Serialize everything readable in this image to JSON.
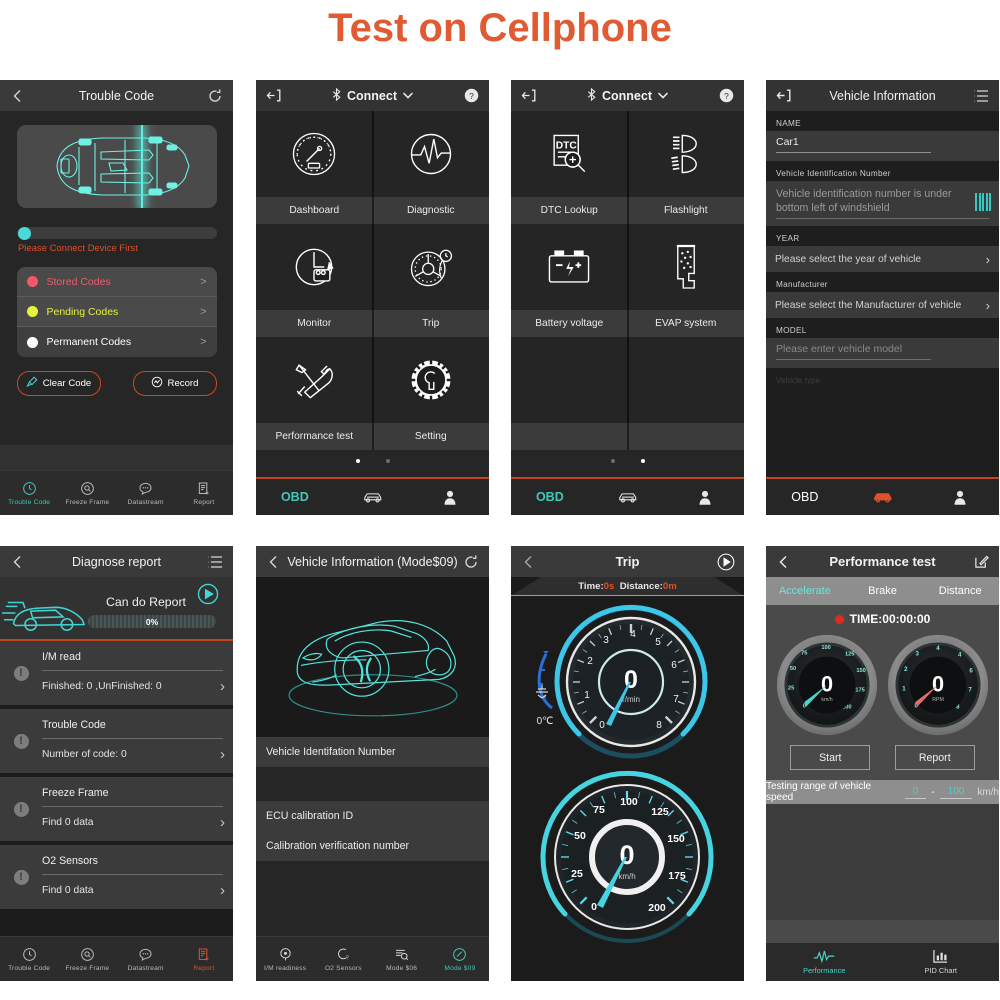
{
  "page": {
    "title": "Test on Cellphone",
    "title_color": "#e05a33"
  },
  "panels": {
    "trouble_code": {
      "header": {
        "back": "back-arrow",
        "title": "Trouble Code",
        "refresh": "refresh"
      },
      "progress_message": "Please Connect Device First",
      "codes": [
        {
          "label": "Stored Codes",
          "dot_color": "#f2596b",
          "text_color": "#f2596b",
          "chevron": ">"
        },
        {
          "label": "Pending Codes",
          "dot_color": "#e2f23d",
          "text_color": "#e2f23d",
          "chevron": ">"
        },
        {
          "label": "Permanent Codes",
          "dot_color": "#ffffff",
          "text_color": "#ffffff",
          "chevron": ">"
        }
      ],
      "buttons": {
        "clear": "Clear Code",
        "record": "Record"
      },
      "bottom_nav": [
        {
          "label": "Trouble Code",
          "icon": "clock-icon",
          "active": true
        },
        {
          "label": "Freeze Frame",
          "icon": "freeze-icon",
          "active": false
        },
        {
          "label": "Datastream",
          "icon": "chat-icon",
          "active": false
        },
        {
          "label": "Report",
          "icon": "report-icon",
          "active": false
        }
      ]
    },
    "connect_page1": {
      "header": {
        "title": "Connect",
        "bluetooth": "bluetooth-icon",
        "help": "help-icon",
        "chevron": "chevron-down-icon"
      },
      "tiles": [
        {
          "label": "Dashboard",
          "icon": "gauge-icon"
        },
        {
          "label": "Diagnostic",
          "icon": "pulse-icon"
        },
        {
          "label": "Monitor",
          "icon": "clock-camera-icon"
        },
        {
          "label": "Trip",
          "icon": "wheel-icon"
        },
        {
          "label": "Performance test",
          "icon": "tools-icon"
        },
        {
          "label": "Setting",
          "icon": "gear-wrench-icon"
        }
      ],
      "page_dots": {
        "count": 2,
        "active": 0
      },
      "tabbar": [
        {
          "label": "OBD",
          "active": true
        },
        {
          "label": "",
          "icon": "car-icon",
          "active": false
        },
        {
          "label": "",
          "icon": "person-icon",
          "active": false
        }
      ]
    },
    "connect_page2": {
      "header": {
        "title": "Connect",
        "bluetooth": "bluetooth-icon",
        "help": "help-icon",
        "chevron": "chevron-down-icon"
      },
      "tiles": [
        {
          "label": "DTC Lookup",
          "icon": "dtc-search-icon"
        },
        {
          "label": "Flashlight",
          "icon": "headlight-icon"
        },
        {
          "label": "Battery voltage",
          "icon": "battery-icon"
        },
        {
          "label": "EVAP system",
          "icon": "evap-icon"
        },
        {
          "label": "",
          "icon": ""
        },
        {
          "label": "",
          "icon": ""
        }
      ],
      "page_dots": {
        "count": 2,
        "active": 1
      },
      "tabbar": [
        {
          "label": "OBD",
          "active": true
        },
        {
          "label": "",
          "icon": "car-icon",
          "active": false
        },
        {
          "label": "",
          "icon": "person-icon",
          "active": false
        }
      ]
    },
    "vehicle_information": {
      "header": {
        "title": "Vehicle Information",
        "back": "back-arrow",
        "menu": "list-menu-icon"
      },
      "fields": [
        {
          "label": "NAME",
          "value": "Car1",
          "type": "text"
        },
        {
          "label": "Vehicle Identification Number",
          "placeholder": "Vehicle identification number is under bottom left of windshield",
          "type": "vin"
        },
        {
          "label": "YEAR",
          "placeholder": "Please select the year of vehicle",
          "type": "select"
        },
        {
          "label": "Manufacturer",
          "placeholder": "Please select the Manufacturer of vehicle",
          "type": "select"
        },
        {
          "label": "MODEL",
          "placeholder": "Please enter vehicle model",
          "type": "text"
        },
        {
          "label": "Vehicle type",
          "type": "cut"
        }
      ],
      "tabbar": [
        {
          "label": "OBD",
          "active": false
        },
        {
          "label": "",
          "icon": "car-icon",
          "active": true
        },
        {
          "label": "",
          "icon": "person-icon",
          "active": false
        }
      ]
    },
    "diagnose_report": {
      "header": {
        "title": "Diagnose report",
        "back": "back-arrow",
        "menu": "list-menu-icon"
      },
      "caption": "Can do Report",
      "progress": "0%",
      "play": "play-icon",
      "items": [
        {
          "title": "I/M read",
          "value": "Finished: 0 ,UnFinished: 0",
          "chevron": ">"
        },
        {
          "title": "Trouble Code",
          "value": "Number of code: 0",
          "chevron": ">"
        },
        {
          "title": "Freeze Frame",
          "value": "Find 0 data",
          "chevron": ">"
        },
        {
          "title": "O2 Sensors",
          "value": "Find 0 data",
          "chevron": ">"
        }
      ],
      "bottom_nav": [
        {
          "label": "Trouble Code",
          "icon": "clock-icon",
          "active": false
        },
        {
          "label": "Freeze Frame",
          "icon": "freeze-icon",
          "active": false
        },
        {
          "label": "Datastream",
          "icon": "chat-icon",
          "active": false
        },
        {
          "label": "Report",
          "icon": "report-icon",
          "active": true
        }
      ]
    },
    "mode09": {
      "header": {
        "title": "Vehicle Information (Mode$09)",
        "back": "back-arrow",
        "refresh": "refresh"
      },
      "rows": [
        "Vehicle Identifation Number",
        "ECU calibration ID",
        "Calibration verification number"
      ],
      "bottom_nav": [
        {
          "label": "I/M readiness",
          "icon": "readiness-icon",
          "active": false
        },
        {
          "label": "O2 Sensors",
          "icon": "o2-icon",
          "active": false
        },
        {
          "label": "Mode $06",
          "icon": "mode06-icon",
          "active": false
        },
        {
          "label": "Mode $09",
          "icon": "mode09-icon",
          "active": true
        }
      ]
    },
    "trip": {
      "header": {
        "title": "Trip",
        "back": "back-arrow",
        "play": "play-icon"
      },
      "status": {
        "time_label": "Time:",
        "time_value": "0s",
        "distance_label": "Distance:",
        "distance_value": "0m"
      },
      "tach": {
        "value": "0",
        "unit": "r/min",
        "ticks": [
          "0",
          "1",
          "2",
          "3",
          "4",
          "5",
          "6",
          "7",
          "8"
        ]
      },
      "speedo": {
        "value": "0",
        "unit": "km/h",
        "ticks": [
          "0",
          "25",
          "50",
          "75",
          "100",
          "125",
          "150",
          "175",
          "200"
        ]
      },
      "temperature": "0℃"
    },
    "performance_test": {
      "header": {
        "title": "Performance test",
        "back": "back-arrow",
        "edit": "edit-icon"
      },
      "tabs": [
        {
          "label": "Accelerate",
          "active": true
        },
        {
          "label": "Brake",
          "active": false
        },
        {
          "label": "Distance",
          "active": false
        }
      ],
      "timer": "TIME:00:00:00",
      "gauges": [
        {
          "value": "0",
          "unit": "km/h",
          "ticks": [
            "0",
            "25",
            "50",
            "75",
            "100",
            "125",
            "150",
            "175",
            "200"
          ],
          "needle_color": "#4ad3c8"
        },
        {
          "value": "0",
          "unit": "RPM",
          "ticks": [
            "0",
            "1",
            "2",
            "3",
            "4",
            "5",
            "6",
            "7",
            "8"
          ],
          "needle_color": "#e07070"
        }
      ],
      "buttons": {
        "start": "Start",
        "report": "Report"
      },
      "range": {
        "label": "Testing range of vehicle speed",
        "min": "0",
        "dash": "-",
        "max": "100",
        "unit": "km/h"
      },
      "bottom_nav": [
        {
          "label": "Performance",
          "icon": "pulse-icon",
          "active": true
        },
        {
          "label": "PID Chart",
          "icon": "bar-chart-icon",
          "active": false
        }
      ]
    }
  }
}
